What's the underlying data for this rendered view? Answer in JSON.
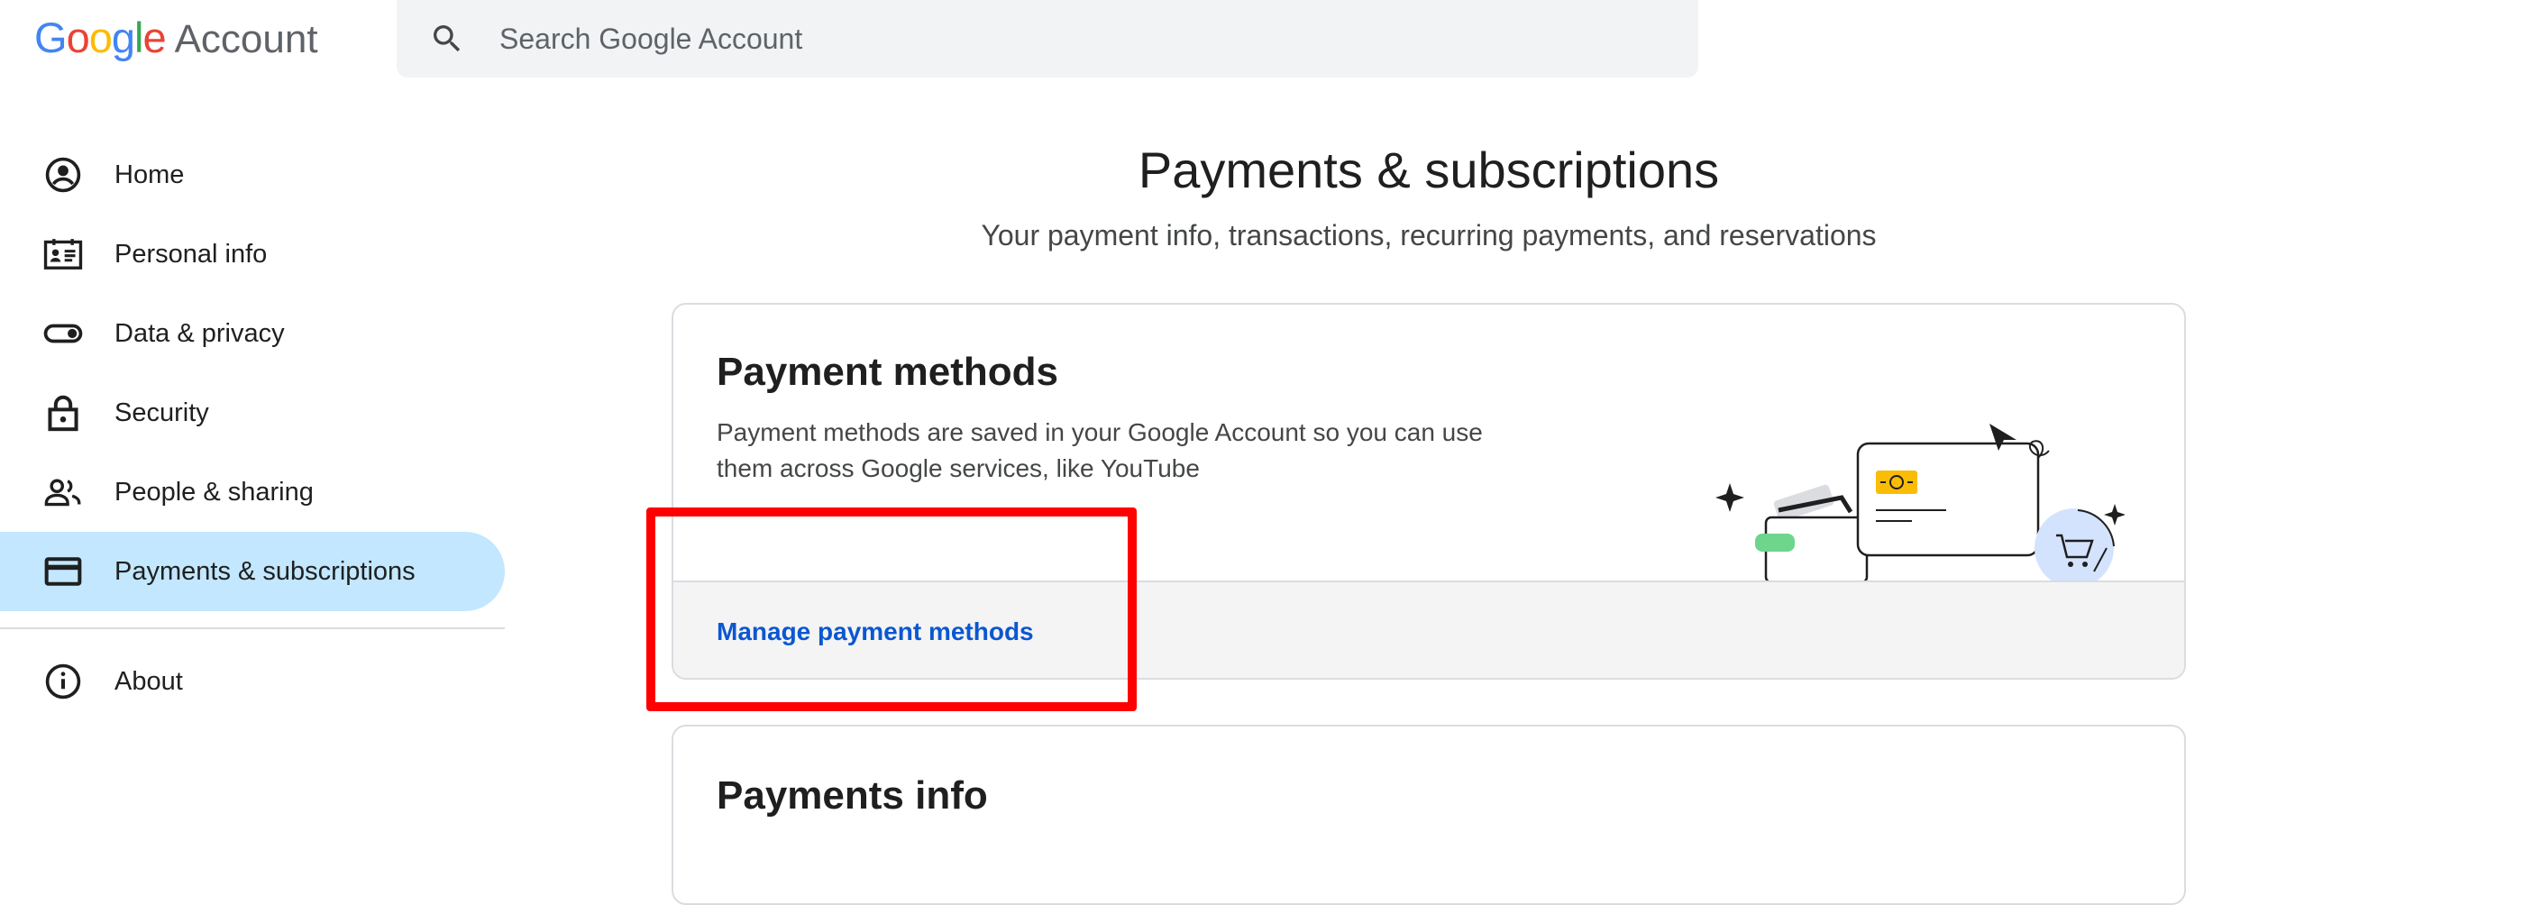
{
  "app": {
    "logo_google": "Google",
    "logo_account": "Account"
  },
  "search": {
    "placeholder": "Search Google Account",
    "icon": "search-icon"
  },
  "sidebar": {
    "items": [
      {
        "label": "Home",
        "icon": "account-circle-icon",
        "active": false
      },
      {
        "label": "Personal info",
        "icon": "id-card-icon",
        "active": false
      },
      {
        "label": "Data & privacy",
        "icon": "toggle-icon",
        "active": false
      },
      {
        "label": "Security",
        "icon": "lock-icon",
        "active": false
      },
      {
        "label": "People & sharing",
        "icon": "people-icon",
        "active": false
      },
      {
        "label": "Payments & subscriptions",
        "icon": "credit-card-icon",
        "active": true
      },
      {
        "label": "About",
        "icon": "info-icon",
        "active": false
      }
    ]
  },
  "main": {
    "title": "Payments & subscriptions",
    "subtitle": "Your payment info, transactions, recurring payments, and reservations",
    "payment_methods": {
      "title": "Payment methods",
      "description": "Payment methods are saved in your Google Account so you can use them across Google services, like YouTube",
      "link": "Manage payment methods"
    },
    "payments_info": {
      "title": "Payments info"
    }
  },
  "colors": {
    "active_nav": "#c2e7ff",
    "link": "#0b57d0",
    "highlight": "#ff0000",
    "search_bg": "#f1f3f4"
  }
}
